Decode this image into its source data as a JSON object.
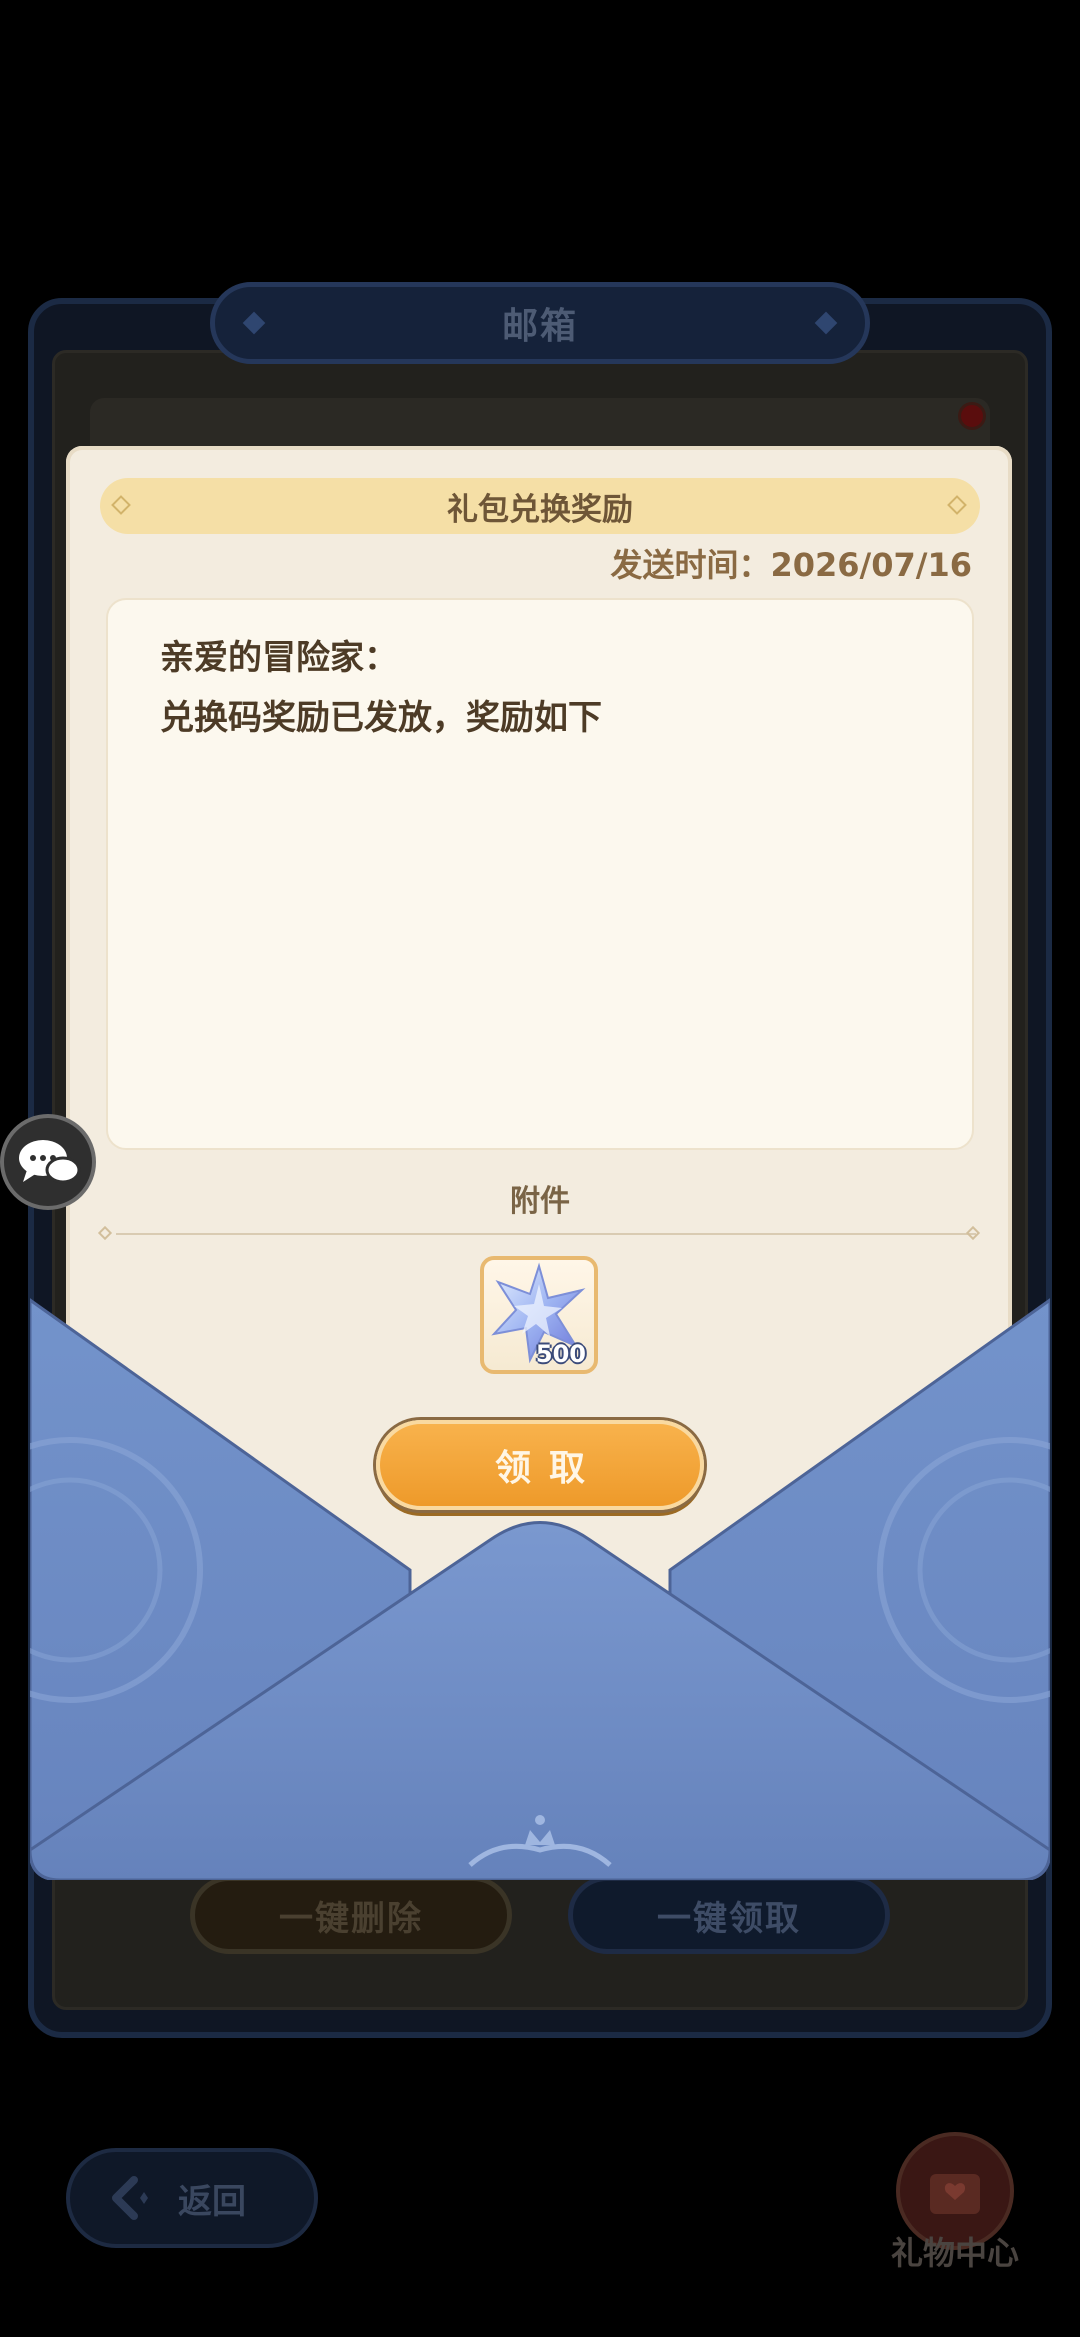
{
  "mailbox": {
    "title": "邮箱",
    "delete_all_label": "一键删除",
    "claim_all_label": "一键领取"
  },
  "navigation": {
    "back_label": "返回",
    "gift_center_label": "礼物中心"
  },
  "letter": {
    "subject": "礼包兑换奖励",
    "send_time": "发送时间：2026/07/16",
    "greeting": "亲爱的冒险家：",
    "body": "兑换码奖励已发放，奖励如下",
    "attachment_label": "附件",
    "attachments": [
      {
        "icon": "crystal-star-icon",
        "quantity": "500"
      }
    ],
    "claim_label": "领取"
  },
  "colors": {
    "accent": "#ee9a2a",
    "envelope": "#7191c7",
    "card": "#f3ecdf"
  }
}
